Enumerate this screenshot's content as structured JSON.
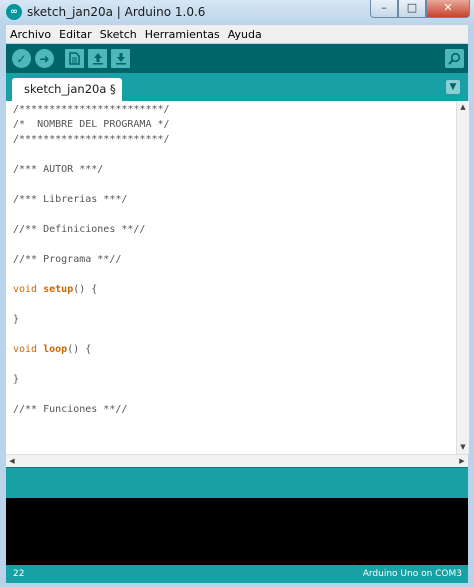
{
  "window": {
    "title": "sketch_jan20a | Arduino 1.0.6",
    "controls": {
      "minimize": "–",
      "maximize": "□",
      "close": "✕"
    },
    "icon": "arduino-logo-icon"
  },
  "menu": {
    "items": [
      "Archivo",
      "Editar",
      "Sketch",
      "Herramientas",
      "Ayuda"
    ]
  },
  "toolbar": {
    "buttons": [
      "verify-icon",
      "upload-icon",
      "new-file-icon",
      "open-icon",
      "save-icon",
      "serial-monitor-icon"
    ]
  },
  "tabs": {
    "active": "sketch_jan20a §",
    "menu_icon": "▼"
  },
  "code": {
    "lines": [
      "/************************/",
      "/*  NOMBRE DEL PROGRAMA */",
      "/************************/",
      "",
      "/*** AUTOR ***/",
      "",
      "/*** Librerias ***/",
      "",
      "//** Definiciones **//",
      "",
      "//** Programa **//",
      "",
      "void setup() {",
      "",
      "}",
      "",
      "void loop() {",
      "",
      "}",
      "",
      "//** Funciones **//"
    ]
  },
  "status": {
    "line_number": "22",
    "board": "Arduino Uno on COM3"
  },
  "colors": {
    "toolbar": "#006468",
    "tabstrip": "#17a1a5",
    "keyword": "#cc6600",
    "console": "#000000"
  }
}
